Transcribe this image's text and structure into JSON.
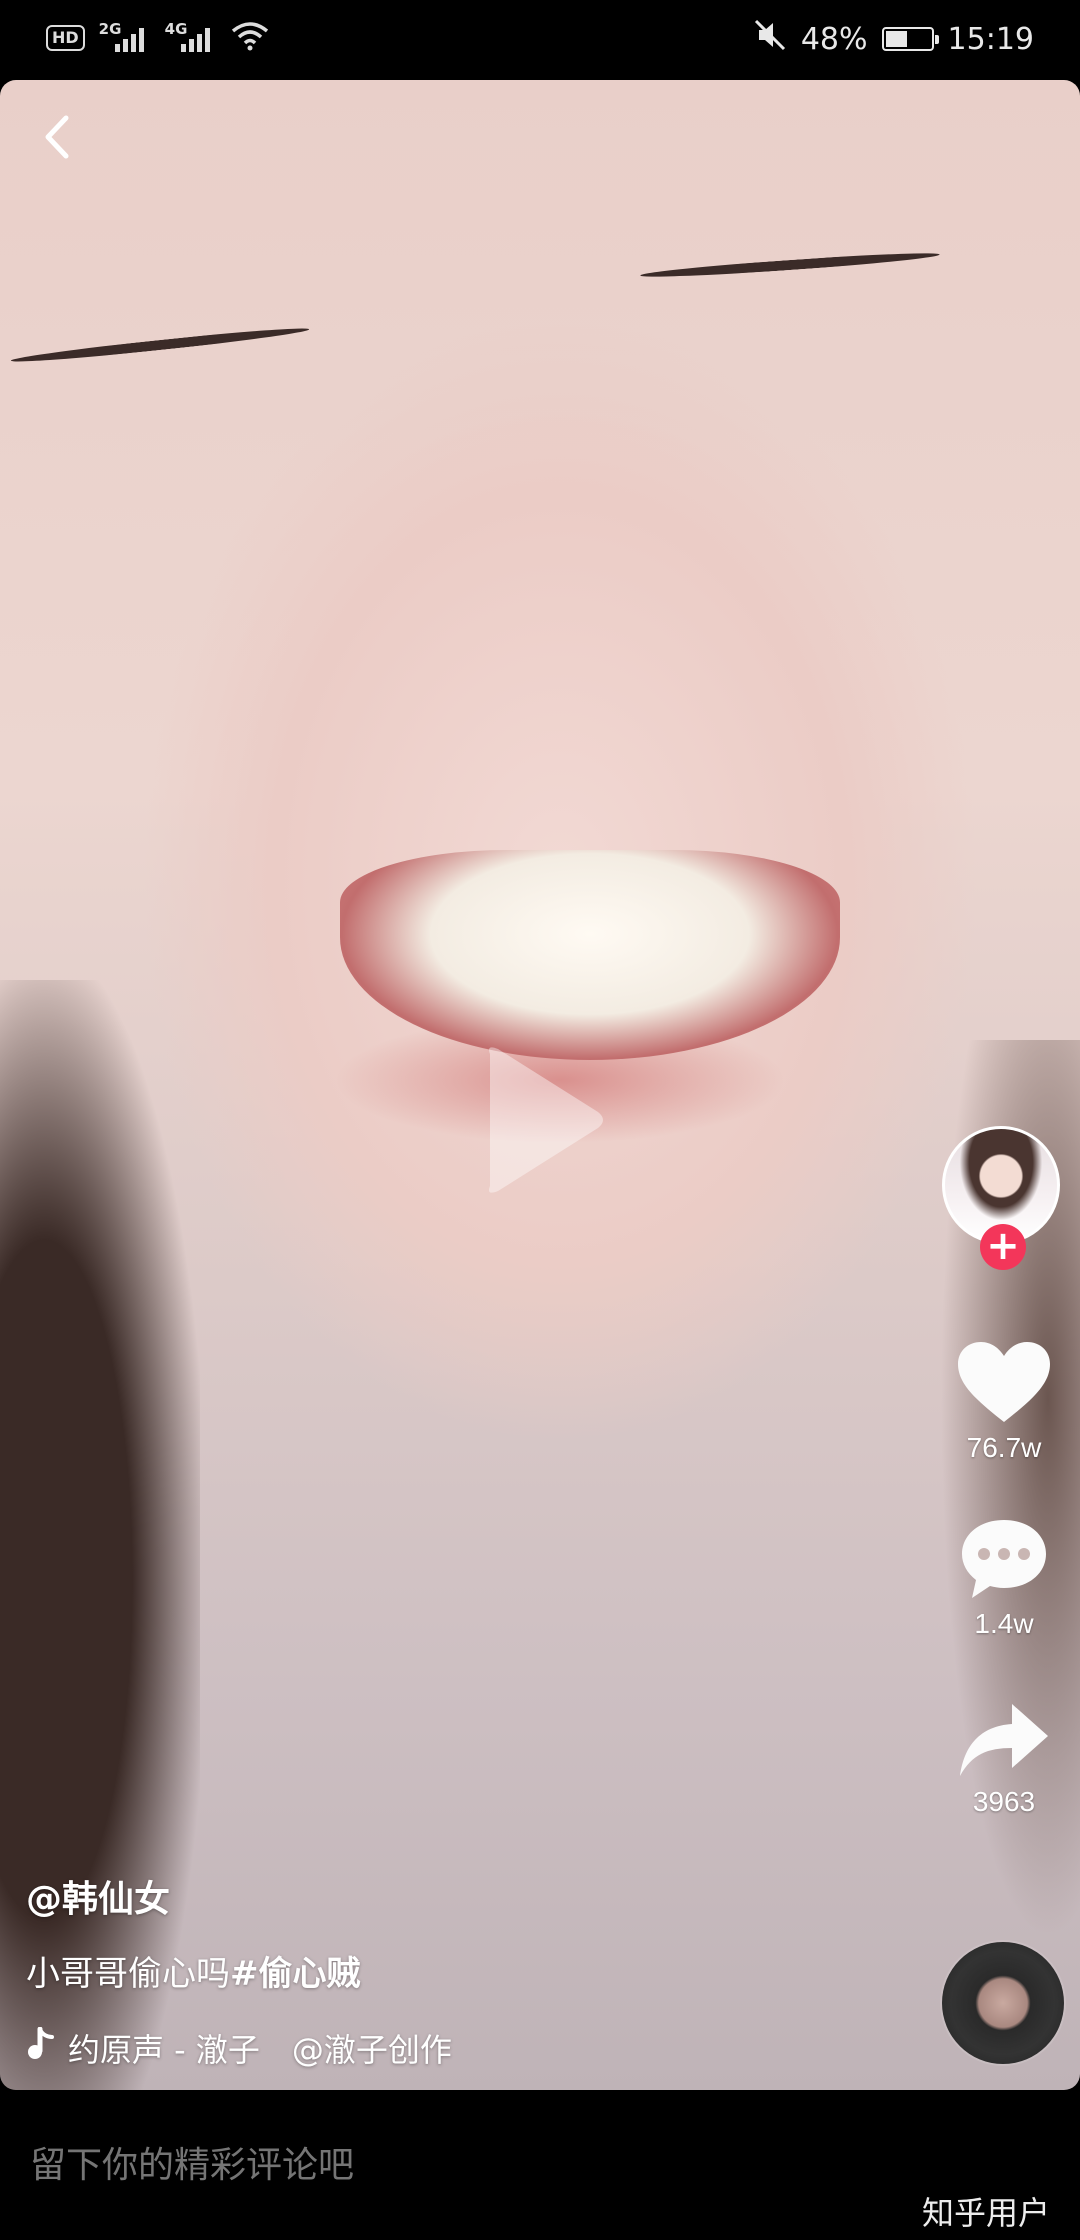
{
  "status_bar": {
    "hd": "HD",
    "network_1": "2G",
    "network_2": "4G",
    "battery": "48%",
    "time": "15:19",
    "battery_level": 0.48
  },
  "video": {
    "author": "@韩仙女",
    "description": "小哥哥偷心吗",
    "hashtag": "#偷心贼",
    "music": "约原声 - 澈子　@澈子创作"
  },
  "actions": {
    "likes": "76.7w",
    "comments": "1.4w",
    "shares": "3963"
  },
  "icons": {
    "back": "back-chevron-icon",
    "play": "play-icon",
    "like": "heart-icon",
    "comment": "comment-bubble-icon",
    "share": "share-arrow-icon",
    "follow": "plus-icon",
    "music": "music-note-icon"
  },
  "colors": {
    "follow_accent": "#f3365a",
    "background": "#000000"
  },
  "bottom": {
    "comment_placeholder": "留下你的精彩评论吧",
    "watermark": "知乎用户"
  }
}
